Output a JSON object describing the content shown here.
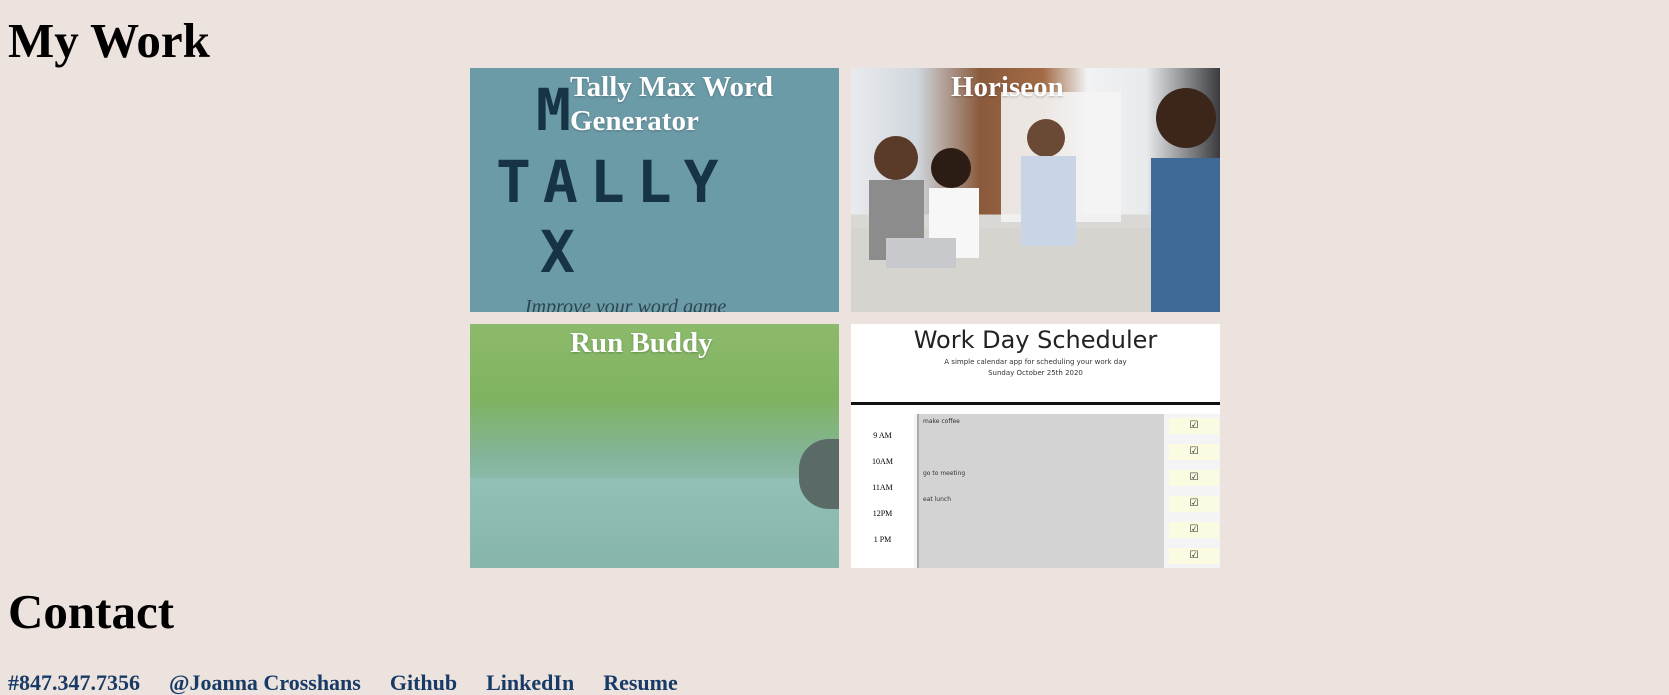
{
  "work": {
    "title": "My Work",
    "projects": [
      {
        "title": "Tally Max Word Generator",
        "thumb": {
          "logo_m": "M",
          "logo_word": "TALLY",
          "logo_x": "X",
          "tagline": "Improve your word game"
        }
      },
      {
        "title": "Horiseon"
      },
      {
        "title": "Run Buddy"
      },
      {
        "title": "",
        "thumb": {
          "heading": "Work Day Scheduler",
          "subtitle": "A simple calendar app for scheduling your work day",
          "date": "Sunday October 25th 2020",
          "rows": [
            {
              "hour": "9 AM",
              "event": "make coffee",
              "save": "☑"
            },
            {
              "hour": "10AM",
              "event": "",
              "save": "☑"
            },
            {
              "hour": "11AM",
              "event": "go to meeting",
              "save": "☑"
            },
            {
              "hour": "12PM",
              "event": "eat lunch",
              "save": "☑"
            },
            {
              "hour": "1 PM",
              "event": "",
              "save": "☑"
            },
            {
              "hour": "",
              "event": "",
              "save": "☑"
            }
          ]
        }
      }
    ]
  },
  "contact": {
    "title": "Contact",
    "links": [
      "#847.347.7356",
      "@Joanna Crosshans",
      "Github",
      "LinkedIn",
      "Resume"
    ]
  },
  "colors": {
    "background": "#ede3de",
    "link": "#173a66",
    "tally_bg": "#6b9ba7"
  }
}
